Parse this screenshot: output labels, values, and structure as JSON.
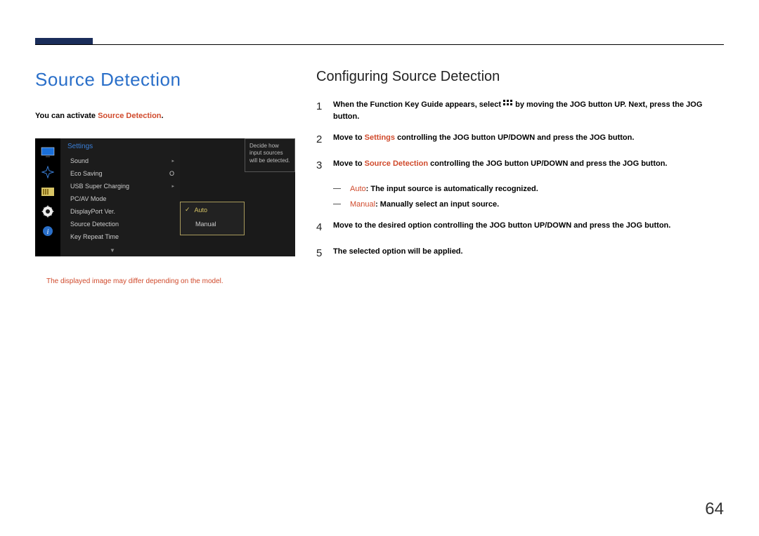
{
  "page_number": "64",
  "left": {
    "title": "Source Detection",
    "intro_prefix": "You can activate ",
    "intro_highlight": "Source Detection",
    "intro_suffix": ".",
    "disclaimer": "The displayed image may differ depending on the model."
  },
  "osd": {
    "menu_title": "Settings",
    "items": [
      {
        "label": "Sound",
        "value": "",
        "arrow": true
      },
      {
        "label": "Eco Saving",
        "value": "O",
        "arrow": false
      },
      {
        "label": "USB Super Charging",
        "value": "",
        "arrow": true
      },
      {
        "label": "PC/AV Mode",
        "value": "",
        "arrow": false
      },
      {
        "label": "DisplayPort Ver.",
        "value": "",
        "arrow": false
      },
      {
        "label": "Source Detection",
        "value": "",
        "arrow": false
      },
      {
        "label": "Key Repeat Time",
        "value": "",
        "arrow": false
      }
    ],
    "sub_options": {
      "auto": "Auto",
      "manual": "Manual"
    },
    "tooltip": "Decide how input sources will be detected.",
    "scroll_indicator": "▼"
  },
  "right": {
    "title": "Configuring Source Detection",
    "steps": {
      "s1_a": "When the Function Key Guide appears, select ",
      "s1_b": " by moving the JOG button UP. Next, press the JOG button.",
      "s2_a": "Move to ",
      "s2_hl": "Settings",
      "s2_b": " controlling the JOG button UP/DOWN and press the JOG button.",
      "s3_a": "Move to ",
      "s3_hl": "Source Detection",
      "s3_b": " controlling the JOG button UP/DOWN and press the JOG button.",
      "s4": "Move to the desired option controlling the JOG button UP/DOWN and press the JOG button.",
      "s5": "The selected option will be applied."
    },
    "bullets": {
      "b1_hl": "Auto",
      "b1_txt": ": The input source is automatically recognized.",
      "b2_hl": "Manual",
      "b2_txt": ": Manually select an input source."
    },
    "bullet_marker": "‒‒"
  }
}
